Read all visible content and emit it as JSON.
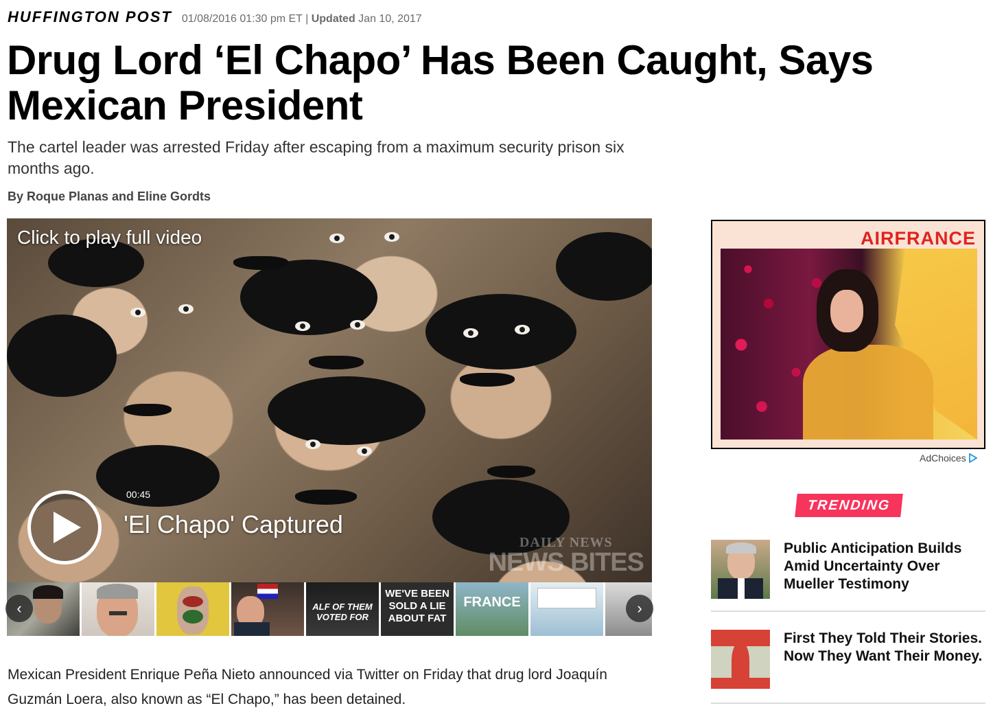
{
  "header": {
    "brand": "HUFFINGTON POST",
    "date": "01/08/2016 01:30 pm ET |",
    "updated_label": "Updated",
    "updated_date": "Jan 10, 2017"
  },
  "article": {
    "headline": "Drug Lord ‘El Chapo’ Has Been Caught, Says Mexican President",
    "subhead": "The cartel leader was arrested Friday after escaping from a maximum security prison six months ago.",
    "byline": "By Roque Planas and Eline Gordts",
    "body": "Mexican President Enrique Peña Nieto announced via Twitter on Friday that drug lord Joaquín Guzmán Loera, also known as “El Chapo,” has been detained."
  },
  "video": {
    "click_label": "Click to play full video",
    "duration": "00:45",
    "title": "'El Chapo' Captured",
    "watermark_top": "DAILY NEWS",
    "watermark_bottom": "NEWS BITES"
  },
  "thumbnails": [
    {
      "caption": ""
    },
    {
      "caption": ""
    },
    {
      "caption": ""
    },
    {
      "caption": ""
    },
    {
      "caption": "ALF OF THEM VOTED FOR"
    },
    {
      "caption": "WE'VE BEEN SOLD A LIE ABOUT FAT"
    },
    {
      "caption": "FRANCE"
    },
    {
      "caption": ""
    },
    {
      "caption": ""
    }
  ],
  "ad": {
    "brand": "AIRFRANCE",
    "choices_label": "AdChoices"
  },
  "trending": {
    "label": "TRENDING",
    "items": [
      {
        "title": "Public Anticipation Builds Amid Uncertainty Over Mueller Testimony"
      },
      {
        "title": "First They Told Their Stories. Now They Want Their Money."
      }
    ]
  },
  "colors": {
    "trending_badge": "#f7345c",
    "airfrance_red": "#e1231e"
  }
}
